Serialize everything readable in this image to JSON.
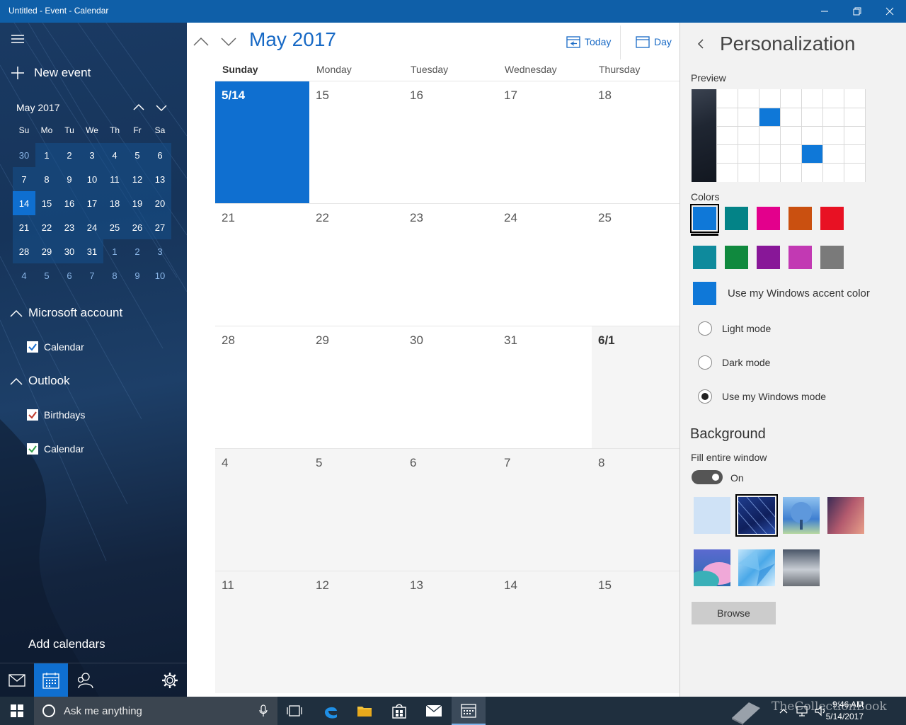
{
  "window": {
    "title": "Untitled - Event - Calendar"
  },
  "sidebar": {
    "new_event_label": "New event",
    "mini_calendar": {
      "month_label": "May 2017",
      "weekdays": [
        "Su",
        "Mo",
        "Tu",
        "We",
        "Th",
        "Fr",
        "Sa"
      ],
      "weeks": [
        [
          {
            "d": "30",
            "m": "out"
          },
          {
            "d": "1",
            "m": "in"
          },
          {
            "d": "2",
            "m": "in"
          },
          {
            "d": "3",
            "m": "in"
          },
          {
            "d": "4",
            "m": "in"
          },
          {
            "d": "5",
            "m": "in"
          },
          {
            "d": "6",
            "m": "in"
          }
        ],
        [
          {
            "d": "7",
            "m": "in"
          },
          {
            "d": "8",
            "m": "in"
          },
          {
            "d": "9",
            "m": "in"
          },
          {
            "d": "10",
            "m": "in"
          },
          {
            "d": "11",
            "m": "in"
          },
          {
            "d": "12",
            "m": "in"
          },
          {
            "d": "13",
            "m": "in"
          }
        ],
        [
          {
            "d": "14",
            "m": "sel"
          },
          {
            "d": "15",
            "m": "in"
          },
          {
            "d": "16",
            "m": "in"
          },
          {
            "d": "17",
            "m": "in"
          },
          {
            "d": "18",
            "m": "in"
          },
          {
            "d": "19",
            "m": "in"
          },
          {
            "d": "20",
            "m": "in"
          }
        ],
        [
          {
            "d": "21",
            "m": "in"
          },
          {
            "d": "22",
            "m": "in"
          },
          {
            "d": "23",
            "m": "in"
          },
          {
            "d": "24",
            "m": "in"
          },
          {
            "d": "25",
            "m": "in"
          },
          {
            "d": "26",
            "m": "in"
          },
          {
            "d": "27",
            "m": "in"
          }
        ],
        [
          {
            "d": "28",
            "m": "in"
          },
          {
            "d": "29",
            "m": "in"
          },
          {
            "d": "30",
            "m": "in"
          },
          {
            "d": "31",
            "m": "in"
          },
          {
            "d": "1",
            "m": "out"
          },
          {
            "d": "2",
            "m": "out"
          },
          {
            "d": "3",
            "m": "out"
          }
        ],
        [
          {
            "d": "4",
            "m": "out"
          },
          {
            "d": "5",
            "m": "out"
          },
          {
            "d": "6",
            "m": "out"
          },
          {
            "d": "7",
            "m": "out"
          },
          {
            "d": "8",
            "m": "out"
          },
          {
            "d": "9",
            "m": "out"
          },
          {
            "d": "10",
            "m": "out"
          }
        ]
      ]
    },
    "accounts": [
      {
        "name": "Microsoft account",
        "calendars": [
          {
            "label": "Calendar",
            "color": "#1a6fd0",
            "checked": true
          }
        ]
      },
      {
        "name": "Outlook",
        "calendars": [
          {
            "label": "Birthdays",
            "color": "#c0392b",
            "checked": true
          },
          {
            "label": "Calendar",
            "color": "#2e9e48",
            "checked": true
          }
        ]
      }
    ],
    "add_calendars_label": "Add calendars"
  },
  "main": {
    "month_title": "May 2017",
    "today_label": "Today",
    "day_label": "Day",
    "weekday_headers": [
      "Sunday",
      "Monday",
      "Tuesday",
      "Wednesday",
      "Thursday"
    ],
    "weeks": [
      [
        {
          "n": "5/14",
          "t": "today"
        },
        {
          "n": "15",
          "t": "cur"
        },
        {
          "n": "16",
          "t": "cur"
        },
        {
          "n": "17",
          "t": "cur"
        },
        {
          "n": "18",
          "t": "cur"
        }
      ],
      [
        {
          "n": "21",
          "t": "cur"
        },
        {
          "n": "22",
          "t": "cur"
        },
        {
          "n": "23",
          "t": "cur"
        },
        {
          "n": "24",
          "t": "cur"
        },
        {
          "n": "25",
          "t": "cur"
        }
      ],
      [
        {
          "n": "28",
          "t": "cur"
        },
        {
          "n": "29",
          "t": "cur"
        },
        {
          "n": "30",
          "t": "cur"
        },
        {
          "n": "31",
          "t": "cur"
        },
        {
          "n": "6/1",
          "t": "firstmonth"
        }
      ],
      [
        {
          "n": "4",
          "t": "other"
        },
        {
          "n": "5",
          "t": "other"
        },
        {
          "n": "6",
          "t": "other"
        },
        {
          "n": "7",
          "t": "other"
        },
        {
          "n": "8",
          "t": "other"
        }
      ],
      [
        {
          "n": "11",
          "t": "other"
        },
        {
          "n": "12",
          "t": "other"
        },
        {
          "n": "13",
          "t": "other"
        },
        {
          "n": "14",
          "t": "other"
        },
        {
          "n": "15",
          "t": "other"
        }
      ]
    ]
  },
  "personalization": {
    "title": "Personalization",
    "preview_label": "Preview",
    "colors_label": "Colors",
    "colors": [
      "#0f78d8",
      "#038387",
      "#e3008c",
      "#ca5010",
      "#e81123",
      "#0e8a9c",
      "#10893e",
      "#881798",
      "#c239b3",
      "#7a7a7a"
    ],
    "selected_color_index": 0,
    "accent_option_label": "Use my Windows accent color",
    "accent_color": "#0f78d8",
    "modes": [
      {
        "label": "Light mode",
        "selected": false
      },
      {
        "label": "Dark mode",
        "selected": false
      },
      {
        "label": "Use my Windows mode",
        "selected": true
      }
    ],
    "background_heading": "Background",
    "fill_label": "Fill entire window",
    "fill_state": "On",
    "browse_label": "Browse"
  },
  "taskbar": {
    "search_placeholder": "Ask me anything",
    "time": "9:46 AM",
    "date": "5/14/2017",
    "watermark": "TheCollectionBook"
  }
}
